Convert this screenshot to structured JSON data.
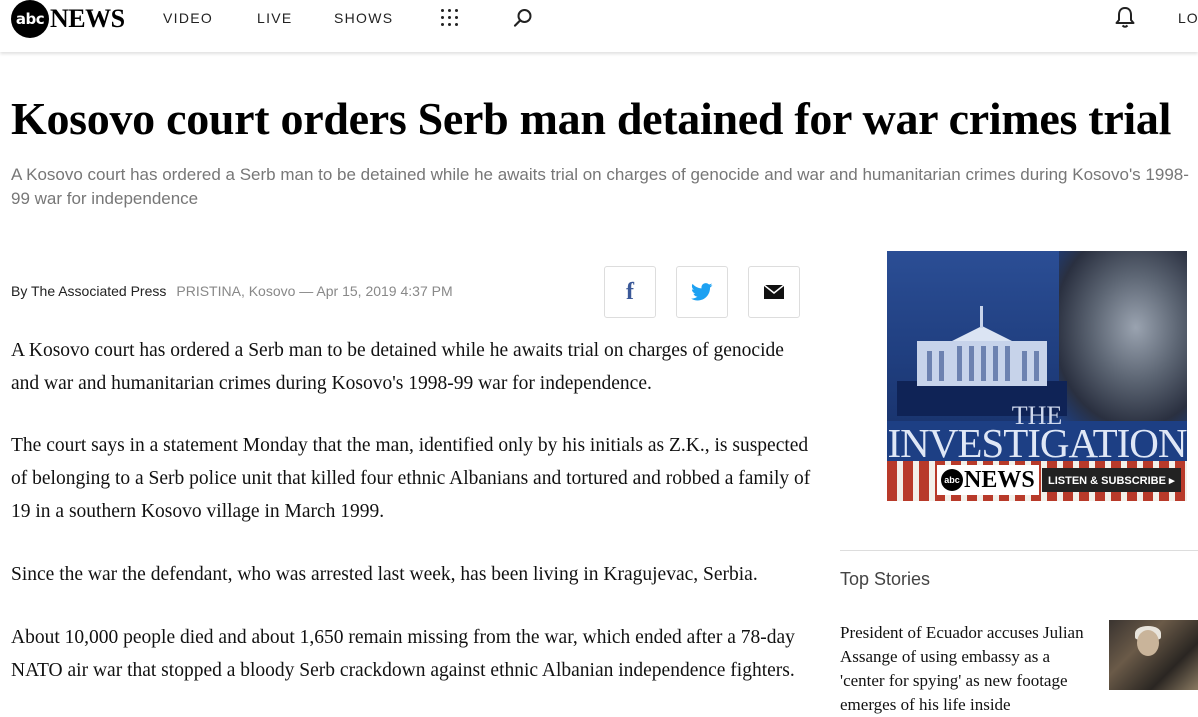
{
  "nav": {
    "logo_abc": "abc",
    "logo_news": "NEWS",
    "links": [
      "VIDEO",
      "LIVE",
      "SHOWS"
    ],
    "login": "LO",
    "icons": {
      "menu": "grid-dots-icon",
      "search": "search-icon",
      "notifications": "bell-icon"
    }
  },
  "article": {
    "headline": "Kosovo court orders Serb man detained for war crimes trial",
    "subhead": "A Kosovo court has ordered a Serb man to be detained while he awaits trial on charges of genocide and war and humanitarian crimes during Kosovo's 1998-99 war for independence",
    "byline": "By The Associated Press",
    "dateline": "PRISTINA, Kosovo — Apr 15, 2019 4:37 PM",
    "share": {
      "facebook": "f",
      "twitter": "twitter-icon",
      "email": "email-icon"
    },
    "paragraphs": [
      "A Kosovo court has ordered a Serb man to be detained while he awaits trial on charges of genocide and war and humanitarian crimes during Kosovo's 1998-99 war for independence.",
      "The court says in a statement Monday that the man, identified only by his initials as Z.K., is suspected of belonging to a Serb police unit that killed four ethnic Albanians and tortured and robbed a family of 19 in a southern Kosovo village in March 1999.",
      "Since the war the defendant, who was arrested last week, has been living in Kragujevac, Serbia.",
      "About 10,000 people died and about 1,650 remain missing from the war, which ended after a 78-day NATO air war that stopped a bloody Serb crackdown against ethnic Albanian independence fighters."
    ]
  },
  "ad": {
    "the": "THE",
    "investigation": "INVESTIGATION",
    "brand_abc": "abc",
    "brand_news": "NEWS",
    "cta": "LISTEN & SUBSCRIBE ▸"
  },
  "sidebar": {
    "top_stories_heading": "Top Stories",
    "story_title": "President of Ecuador accuses Julian Assange of using embassy as a 'center for spying' as new footage emerges of his life inside"
  },
  "colors": {
    "ad_blue": "#1d3f84",
    "ad_red": "#b83a2a",
    "facebook": "#3b5998",
    "twitter": "#1da1f2"
  }
}
